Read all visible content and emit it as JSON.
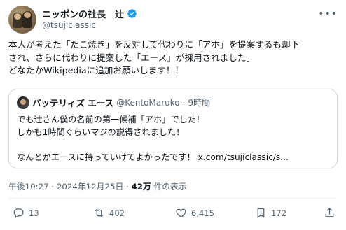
{
  "author": {
    "display_name": "ニッポンの社長　辻",
    "handle": "@tsujiclassic",
    "verified_color": "#1d9bf0"
  },
  "tweet": {
    "text": "本人が考えた「たこ焼き」を反対して代わりに「アホ」を提案するも却下\nされ、さらに代わりに提案した「エース」が採用されました。\nどなたかWikipediaに追加お願いします！！"
  },
  "quote": {
    "display_name": "バッテリィズ エース",
    "handle": "@KentoMaruko",
    "separator": "·",
    "time": "9時間",
    "text": "でも辻さん僕の名前の第一候補「アホ」でした！\nしかも1時間ぐらいマジの説得されました！\n\nなんとかエースに持っていけてよかったです！ x.com/tsujiclassic/s..."
  },
  "meta": {
    "time": "午後10:27",
    "sep1": " · ",
    "date": "2024年12月25日",
    "sep2": " · ",
    "views": "42万",
    "views_suffix": " 件の表示"
  },
  "actions": {
    "reply_count": "13",
    "retweet_count": "402",
    "like_count": "6,415",
    "bookmark_count": "172",
    "icons": [
      "reply-icon",
      "retweet-icon",
      "like-icon",
      "bookmark-icon",
      "share-icon"
    ]
  }
}
